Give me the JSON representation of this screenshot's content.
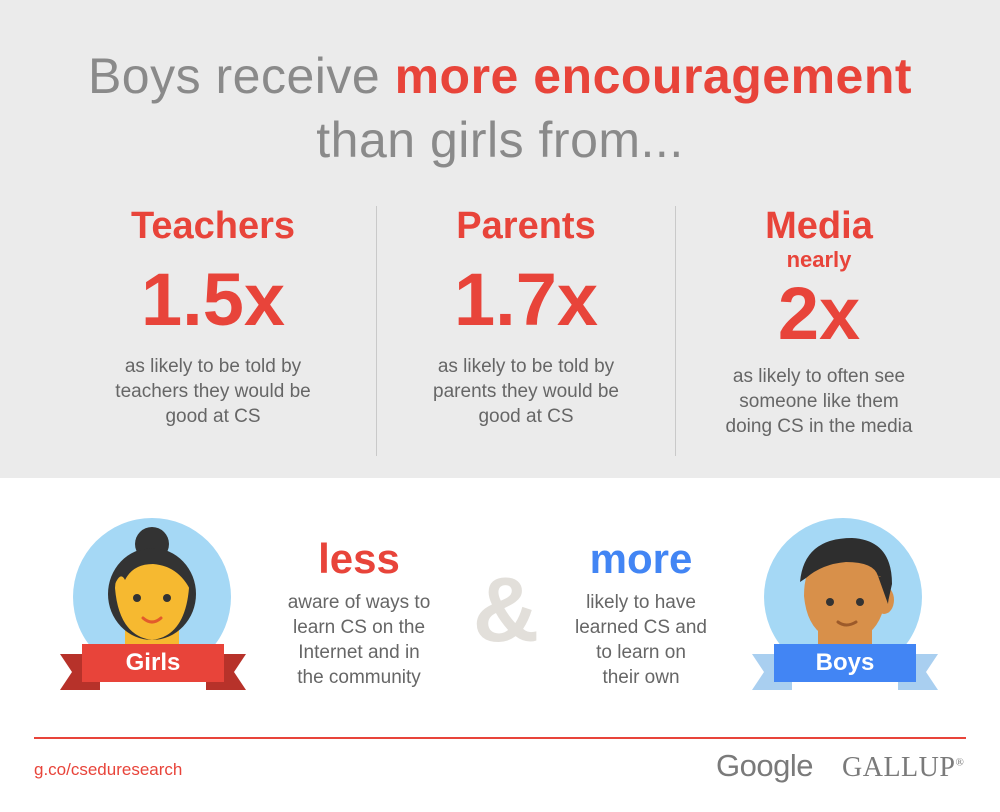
{
  "headline": {
    "line1_pre": "Boys receive ",
    "line1_em": "more encouragement",
    "line2": "than girls from..."
  },
  "columns": [
    {
      "category": "Teachers",
      "prefix": "",
      "value": "1.5x",
      "desc": [
        "as likely to be told by",
        "teachers they would be",
        "good at CS"
      ]
    },
    {
      "category": "Parents",
      "prefix": "",
      "value": "1.7x",
      "desc": [
        "as likely to be told by",
        "parents they would be",
        "good at CS"
      ]
    },
    {
      "category": "Media",
      "prefix": "nearly",
      "value": "2x",
      "desc": [
        "as likely to often see",
        "someone like them",
        "doing CS in the media"
      ]
    }
  ],
  "girls": {
    "label": "Girls",
    "big": "less",
    "text": [
      "aware of ways to",
      "learn CS on the",
      "Internet and in",
      "the community"
    ]
  },
  "ampersand": "&",
  "boys": {
    "label": "Boys",
    "big": "more",
    "text": [
      "likely to have",
      "learned CS and",
      "to learn on",
      "their own"
    ]
  },
  "footer": {
    "url": "g.co/cseduresearch",
    "google": "Google",
    "gallup": "GALLUP",
    "gallup_mark": "®"
  },
  "colors": {
    "accent_red": "#e8443a",
    "accent_blue": "#4285f4",
    "top_bg": "#ebebeb",
    "avatar_bg": "#a5d8f5"
  },
  "icons": [
    "girl-avatar-icon",
    "boy-avatar-icon",
    "ribbon-icon"
  ]
}
